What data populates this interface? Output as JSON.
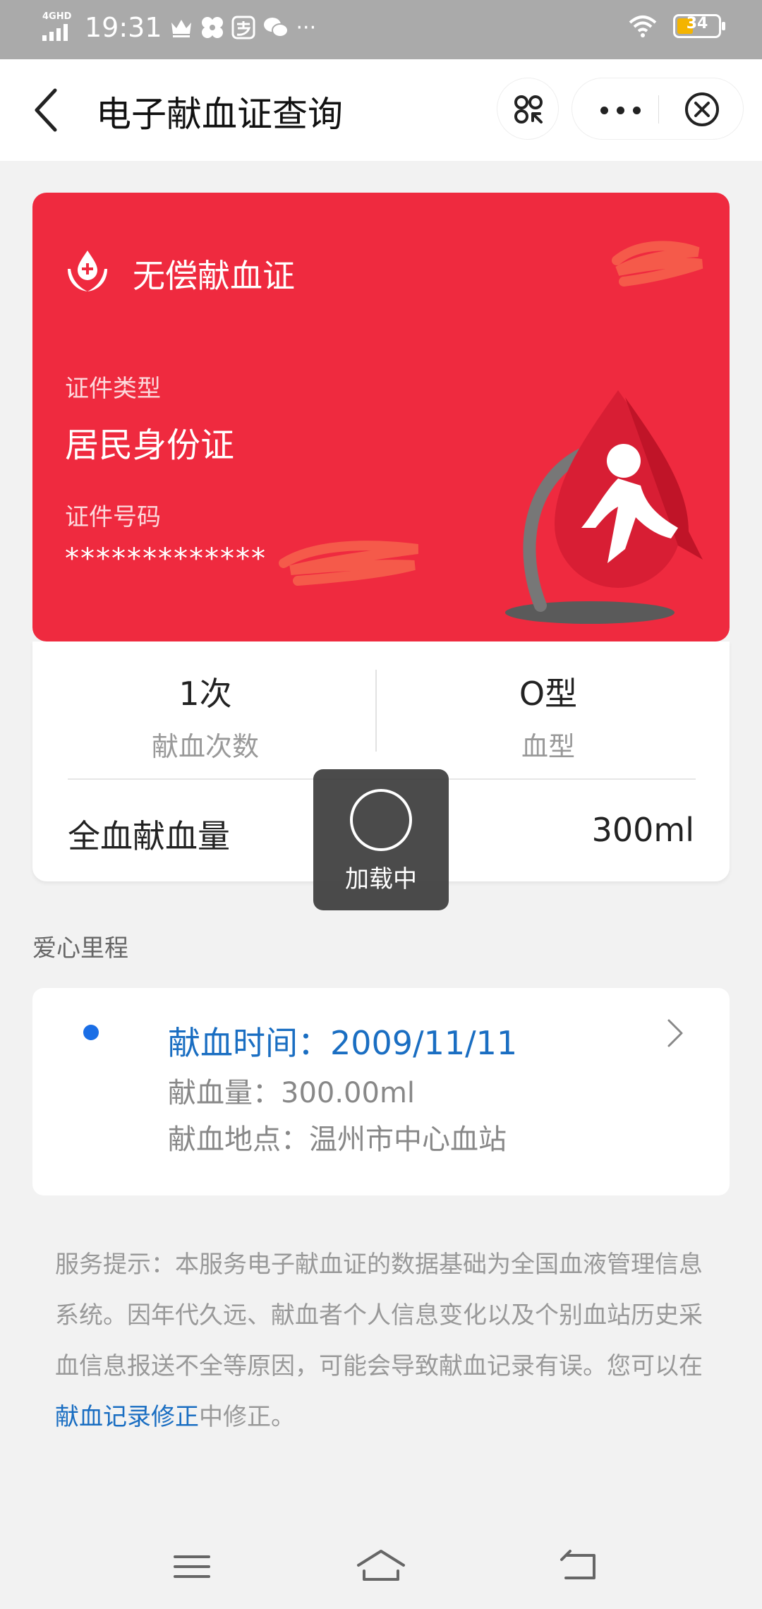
{
  "status_bar": {
    "network": "4GHD",
    "time": "19:31",
    "battery": "34"
  },
  "nav": {
    "title": "电子献血证查询"
  },
  "card": {
    "title": "无偿献血证",
    "id_type_label": "证件类型",
    "id_type_value": "居民身份证",
    "id_number_label": "证件号码",
    "id_number_value": "*************"
  },
  "stats": {
    "count_value": "1次",
    "count_label": "献血次数",
    "blood_type_value": "O型",
    "blood_type_label": "血型",
    "whole_blood_label": "全血献血量",
    "whole_blood_value": "300ml"
  },
  "toast": {
    "text": "加载中"
  },
  "section": {
    "title": "爱心里程"
  },
  "record": {
    "time": "献血时间：2009/11/11",
    "amount": "献血量：300.00ml",
    "location": "献血地点：温州市中心血站"
  },
  "notice": {
    "prefix": "服务提示：本服务电子献血证的数据基础为全国血液管理信息系统。因年代久远、献血者个人信息变化以及个别血站历史采血信息报送不全等原因，可能会导致献血记录有误。您可以在",
    "link": "献血记录修正",
    "suffix": "中修正。"
  },
  "colors": {
    "card_red": "#ef2a3f",
    "link_blue": "#1a6ec2",
    "dot_blue": "#1a6ee6"
  }
}
